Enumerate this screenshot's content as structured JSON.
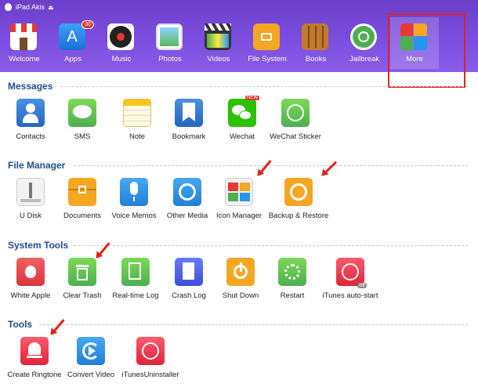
{
  "titlebar": {
    "device": "iPad Akis"
  },
  "toolbar": {
    "items": [
      {
        "label": "Welcome"
      },
      {
        "label": "Apps",
        "badge": "30"
      },
      {
        "label": "Music"
      },
      {
        "label": "Photos"
      },
      {
        "label": "Videos"
      },
      {
        "label": "File System"
      },
      {
        "label": "Books"
      },
      {
        "label": "Jailbreak"
      },
      {
        "label": "More"
      }
    ]
  },
  "sections": {
    "messages": {
      "title": "Messages",
      "items": [
        {
          "label": "Contacts"
        },
        {
          "label": "SMS"
        },
        {
          "label": "Note"
        },
        {
          "label": "Bookmark"
        },
        {
          "label": "Wechat",
          "tag": "NEW"
        },
        {
          "label": "WeChat Sticker"
        }
      ]
    },
    "file_manager": {
      "title": "File Manager",
      "items": [
        {
          "label": "U Disk"
        },
        {
          "label": "Documents"
        },
        {
          "label": "Voice Memos"
        },
        {
          "label": "Other Media"
        },
        {
          "label": "Icon Manager"
        },
        {
          "label": "Backup & Restore"
        }
      ]
    },
    "system_tools": {
      "title": "System Tools",
      "items": [
        {
          "label": "White Apple"
        },
        {
          "label": "Clear Trash"
        },
        {
          "label": "Real-time Log"
        },
        {
          "label": "Crash Log"
        },
        {
          "label": "Shut Down"
        },
        {
          "label": "Restart"
        },
        {
          "label": "iTunes auto-start",
          "tag": "off"
        }
      ]
    },
    "tools": {
      "title": "Tools",
      "items": [
        {
          "label": "Create Ringtone"
        },
        {
          "label": "Convert Video"
        },
        {
          "label": "iTunesUninstaller"
        }
      ]
    }
  },
  "colors": {
    "header": "#7b4ee0",
    "section_title": "#1f4e8c",
    "annotation": "#e0231c"
  }
}
